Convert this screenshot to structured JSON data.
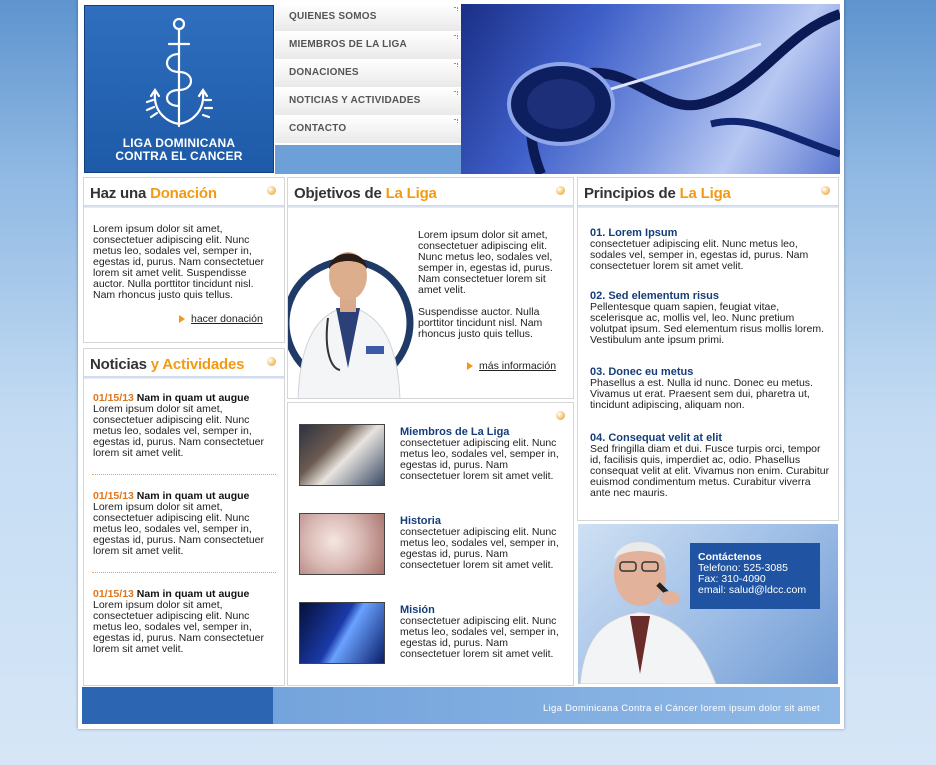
{
  "brand": {
    "logo_line1": "LIGA DOMINICANA",
    "logo_line2": "CONTRA EL CANCER"
  },
  "nav": {
    "items": [
      {
        "label": "QUIENES SOMOS"
      },
      {
        "label": "MIEMBROS DE LA LIGA"
      },
      {
        "label": "DONACIONES"
      },
      {
        "label": "NOTICIAS Y ACTIVIDADES"
      },
      {
        "label": "CONTACTO"
      }
    ]
  },
  "donacion": {
    "title_prefix": "Haz una ",
    "title_highlight": "Donación",
    "body": "Lorem ipsum dolor sit amet, consectetuer adipiscing elit. Nunc metus leo, sodales vel, semper in, egestas id, purus. Nam consectetuer lorem sit amet velit. Suspendisse auctor. Nulla porttitor tincidunt nisl. Nam rhoncus justo quis tellus.",
    "link": "hacer donación"
  },
  "noticias": {
    "title_prefix": "Noticias ",
    "title_highlight": "y Actividades",
    "items": [
      {
        "date": "01/15/13",
        "headline": "Nam in quam ut augue",
        "body": "Lorem ipsum dolor sit amet, consectetuer adipiscing elit. Nunc metus leo, sodales vel, semper in, egestas id, purus. Nam consectetuer lorem sit amet velit."
      },
      {
        "date": "01/15/13",
        "headline": "Nam in quam ut augue",
        "body": "Lorem ipsum dolor sit amet, consectetuer adipiscing elit. Nunc metus leo, sodales vel, semper in, egestas id, purus. Nam consectetuer lorem sit amet velit."
      },
      {
        "date": "01/15/13",
        "headline": "Nam in quam ut augue",
        "body": "Lorem ipsum dolor sit amet, consectetuer adipiscing elit. Nunc metus leo, sodales vel, semper in, egestas id, purus. Nam consectetuer lorem sit amet velit."
      }
    ]
  },
  "objetivos": {
    "title_prefix": "Objetivos de ",
    "title_highlight": "La Liga",
    "p1": "Lorem ipsum dolor sit amet, consectetuer adipiscing elit. Nunc metus leo, sodales vel, semper in, egestas id, purus. Nam consectetuer lorem sit amet velit.",
    "p2": "Suspendisse auctor. Nulla porttitor tincidunt nisl. Nam rhoncus justo quis tellus.",
    "link": "más información"
  },
  "features": {
    "items": [
      {
        "title": "Miembros de La Liga",
        "body": "consectetuer adipiscing elit. Nunc metus leo, sodales vel, semper in, egestas id, purus. Nam consectetuer lorem sit amet velit."
      },
      {
        "title": "Historia",
        "body": "consectetuer adipiscing elit. Nunc metus leo, sodales vel, semper in, egestas id, purus. Nam consectetuer lorem sit amet velit."
      },
      {
        "title": "Misión",
        "body": "consectetuer adipiscing elit. Nunc metus leo, sodales vel, semper in, egestas id, purus. Nam consectetuer lorem sit amet velit."
      }
    ]
  },
  "principios": {
    "title_prefix": "Principios de ",
    "title_highlight": "La Liga",
    "items": [
      {
        "heading": "01. Lorem Ipsum",
        "body": "consectetuer adipiscing elit. Nunc metus leo, sodales vel, semper in, egestas id, purus. Nam consectetuer lorem sit amet velit."
      },
      {
        "heading": "02. Sed elementum risus",
        "body": "Pellentesque quam sapien, feugiat vitae, scelerisque ac, mollis vel, leo. Nunc pretium volutpat ipsum. Sed elementum risus mollis lorem. Vestibulum ante ipsum primi."
      },
      {
        "heading": "03. Donec eu metus",
        "body": "Phasellus a est. Nulla id nunc. Donec eu metus. Vivamus ut erat. Praesent sem dui, pharetra ut, tincidunt adipiscing, aliquam non."
      },
      {
        "heading": "04. Consequat velit at elit",
        "body": "Sed fringilla diam et dui. Fusce turpis orci, tempor id, facilisis quis, imperdiet ac, odio. Phasellus consequat velit at elit. Vivamus non enim. Curabitur euismod condimentum metus. Curabitur viverra ante nec mauris."
      }
    ]
  },
  "contact": {
    "title": "Contáctenos",
    "phone": "Telefono: 525-3085",
    "fax": "Fax: 310-4090",
    "email": "email: salud@ldcc.com"
  },
  "footer": {
    "text": "Liga Dominicana Contra el Cáncer lorem ipsum dolor sit amet"
  },
  "colors": {
    "accent": "#f39a13",
    "brand_blue": "#1d5aa8",
    "heading_blue": "#153d7a"
  }
}
